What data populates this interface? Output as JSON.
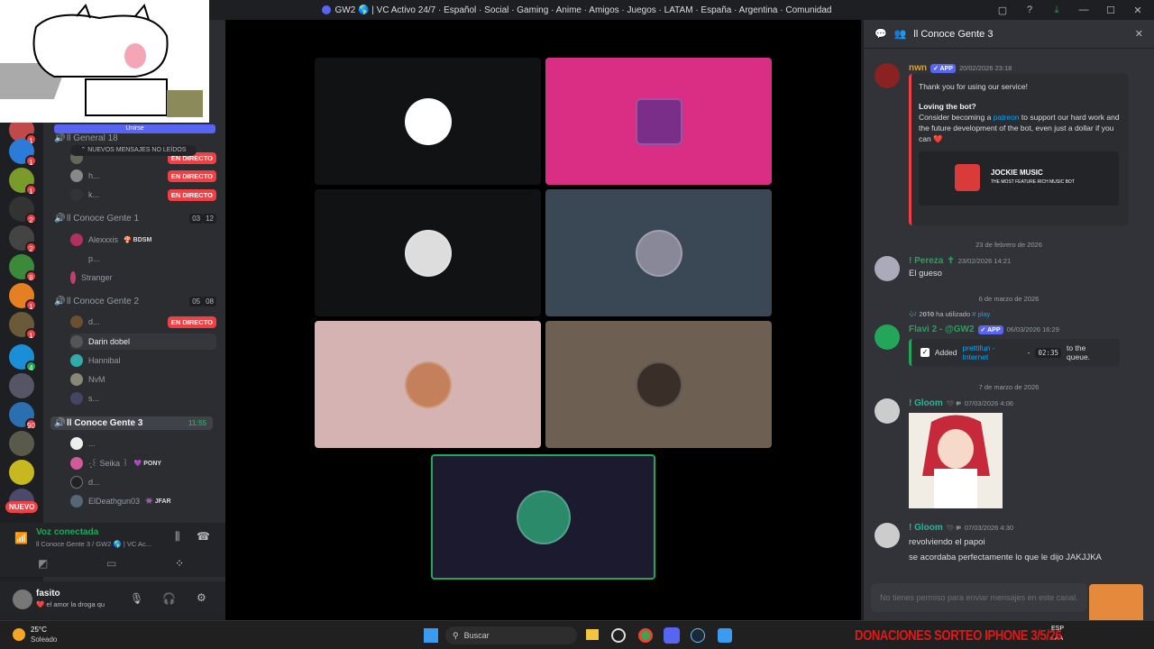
{
  "window": {
    "title": "GW2 🌎 | VC Activo 24/7 · Español · Social · Gaming · Anime · Amigos · Juegos · LATAM · España · Argentina · Comunidad"
  },
  "sidebar": {
    "unread_label": "Unirse",
    "new_messages": "⌃ NUEVOS MENSAJES NO LEÍDOS",
    "nuevo_badge": "NUEVO",
    "badges": [
      "1",
      "1",
      "1",
      "2",
      "2",
      "3",
      "8",
      "1",
      "1",
      "4",
      "1",
      "1",
      "1",
      "90",
      "1"
    ],
    "live_label": "EN DIRECTO",
    "channel_general_label": "ll General 18",
    "channels": [
      {
        "name": "ll Conoce Gente 1",
        "count_a": "03",
        "count_b": "12"
      },
      {
        "name": "ll Conoce Gente 2",
        "count_a": "05",
        "count_b": "08"
      },
      {
        "name": "ll Conoce Gente 3",
        "timer": "11:55"
      }
    ],
    "users_top": [
      {
        "name": "h..."
      },
      {
        "name": "k..."
      }
    ],
    "users_c1": [
      {
        "name": "Alexxxis",
        "tag": "🍄 BDSM"
      },
      {
        "name": "p..."
      },
      {
        "name": "Stranger"
      }
    ],
    "users_c2": [
      {
        "name": "d..."
      },
      {
        "name": "Darin dobel"
      },
      {
        "name": "Hannibal"
      },
      {
        "name": "NvM"
      },
      {
        "name": "s..."
      }
    ],
    "users_c3": [
      {
        "name": "..."
      },
      {
        "name": "·̩͙꒰ Seika ꒱",
        "tag": "💜 PONY"
      },
      {
        "name": "d..."
      },
      {
        "name": "ElDeathgun03",
        "tag": "👾 JFAR"
      }
    ]
  },
  "voice": {
    "status": "Voz conectada",
    "channel": "ll Conoce Gente 3 / GW2 🌎 | VC Ac..."
  },
  "user": {
    "name": "fasito",
    "status": "❤️ el amor la droga qu"
  },
  "weather": {
    "temp": "25°C",
    "desc": "Soleado"
  },
  "taskbar": {
    "search": "Buscar",
    "lang": "ESP",
    "lang2": "LAA"
  },
  "panel": {
    "title": "ll Conoce Gente 3",
    "input_placeholder": "No tienes permiso para enviar mensajes en este canal.",
    "messages": [
      {
        "author": "nwn",
        "app": "✓ APP",
        "time": "20/02/2026 23:18",
        "embed_line1": "Thank you for using our service!",
        "embed_heading": "Loving the bot?",
        "embed_pre": "Consider becoming a",
        "embed_link": "patreon",
        "embed_post": "to support our hard work and the future development of the bot, even just a dollar if you can ❤️",
        "brand": "JOCKIE MUSIC",
        "brand_sub": "THE MOST FEATURE RICH MUSIC BOT"
      },
      {
        "divider": "23 de febrero de 2026"
      },
      {
        "author": "! Pereza",
        "author_suffix": "✝",
        "time": "23/02/2026 14:21",
        "text": "El gueso"
      },
      {
        "divider": "6 de marzo de 2026"
      },
      {
        "reply": "🎶 2𝟎𝟏𝟎 ha utilizado",
        "reply_cmd": "# play",
        "author": "Flavi 2 - @GW2",
        "app": "✓ APP",
        "time": "06/03/2026 16:29",
        "embed_pre": "Added",
        "embed_link": "prettifun - Internet",
        "embed_sep": "-",
        "embed_code": "02:35",
        "embed_post": "to the queue."
      },
      {
        "divider": "7 de marzo de 2026"
      },
      {
        "author": "! Gloom",
        "author_tag": "🖤 ᵍᵉ",
        "time": "07/03/2026 4:06"
      },
      {
        "author": "! Gloom",
        "author_tag": "🖤 ᵍᵉ",
        "time": "07/03/2026 4:30",
        "text": "revolviendo el papoi",
        "text2": "se acordaba perfectamente lo que le dijo JAKJJKA"
      }
    ]
  },
  "overlay": {
    "donation": "DONACIONES SORTEO IPHONE 3/5/26"
  },
  "colors": {
    "accent": "#5865f2",
    "live": "#f23f43",
    "voice": "#23a55a",
    "pink_tile": "#d92e84"
  }
}
